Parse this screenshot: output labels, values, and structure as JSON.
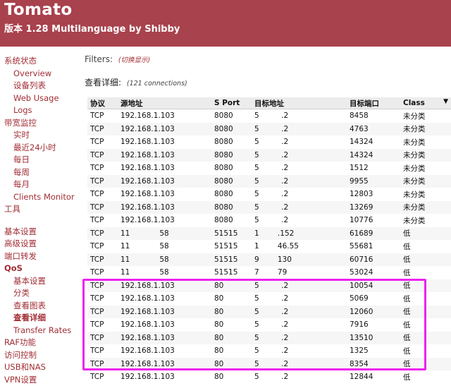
{
  "header": {
    "title": "Tomato",
    "subtitle": "版本 1.28 Multilanguage by Shibby"
  },
  "nav": [
    {
      "label": "系统状态",
      "level": 0
    },
    {
      "label": "Overview",
      "level": 1
    },
    {
      "label": "设备列表",
      "level": 1
    },
    {
      "label": "Web Usage",
      "level": 1
    },
    {
      "label": "Logs",
      "level": 1
    },
    {
      "label": "带宽监控",
      "level": 0
    },
    {
      "label": "实时",
      "level": 1
    },
    {
      "label": "最近24小时",
      "level": 1
    },
    {
      "label": "每日",
      "level": 1
    },
    {
      "label": "每周",
      "level": 1
    },
    {
      "label": "每月",
      "level": 1
    },
    {
      "label": "Clients Monitor",
      "level": 1
    },
    {
      "label": "工具",
      "level": 0
    },
    {
      "gap": true
    },
    {
      "label": "基本设置",
      "level": 0
    },
    {
      "label": "高级设置",
      "level": 0
    },
    {
      "label": "端口转发",
      "level": 0
    },
    {
      "label": "QoS",
      "level": 0,
      "bold": true
    },
    {
      "label": "基本设置",
      "level": 1
    },
    {
      "label": "分类",
      "level": 1
    },
    {
      "label": "查看图表",
      "level": 1
    },
    {
      "label": "查看详细",
      "level": 1,
      "active": true
    },
    {
      "label": "Transfer Rates",
      "level": 1
    },
    {
      "label": "RAF功能",
      "level": 0
    },
    {
      "label": "访问控制",
      "level": 0
    },
    {
      "label": "USB和NAS",
      "level": 0
    },
    {
      "label": "VPN设置",
      "level": 0
    }
  ],
  "filters": {
    "label": "Filters:",
    "toggle": "(切换显示)"
  },
  "details": {
    "title": "查看详细:",
    "count": "(121 connections)"
  },
  "table": {
    "headers": [
      "协议",
      "源地址",
      "S Port",
      "目标地址",
      "目标端口",
      "Class"
    ],
    "rows": [
      [
        "TCP",
        "192.168.1.103",
        "8080",
        "5      .2",
        "8458",
        "未分类"
      ],
      [
        "TCP",
        "192.168.1.103",
        "8080",
        "5      .2",
        "4763",
        "未分类"
      ],
      [
        "TCP",
        "192.168.1.103",
        "8080",
        "5      .2",
        "14324",
        "未分类"
      ],
      [
        "TCP",
        "192.168.1.103",
        "8080",
        "5      .2",
        "14324",
        "未分类"
      ],
      [
        "TCP",
        "192.168.1.103",
        "8080",
        "5      .2",
        "1512",
        "未分类"
      ],
      [
        "TCP",
        "192.168.1.103",
        "8080",
        "5      .2",
        "9955",
        "未分类"
      ],
      [
        "TCP",
        "192.168.1.103",
        "8080",
        "5      .2",
        "12803",
        "未分类"
      ],
      [
        "TCP",
        "192.168.1.103",
        "8080",
        "5      .2",
        "13269",
        "未分类"
      ],
      [
        "TCP",
        "192.168.1.103",
        "8080",
        "5      .2",
        "10776",
        "未分类"
      ],
      [
        "TCP",
        "11        58",
        "51515",
        "1     .152",
        "61689",
        "低"
      ],
      [
        "TCP",
        "11        58",
        "51515",
        "1     46.55",
        "55681",
        "低"
      ],
      [
        "TCP",
        "11        58",
        "51515",
        "9     130",
        "60716",
        "低"
      ],
      [
        "TCP",
        "11        58",
        "51515",
        "7     79",
        "53024",
        "低"
      ],
      [
        "TCP",
        "192.168.1.103",
        "80",
        "5      .2",
        "10054",
        "低"
      ],
      [
        "TCP",
        "192.168.1.103",
        "80",
        "5      .2",
        "5069",
        "低"
      ],
      [
        "TCP",
        "192.168.1.103",
        "80",
        "5      .2",
        "12060",
        "低"
      ],
      [
        "TCP",
        "192.168.1.103",
        "80",
        "5      .2",
        "7916",
        "低"
      ],
      [
        "TCP",
        "192.168.1.103",
        "80",
        "5      .2",
        "13510",
        "低"
      ],
      [
        "TCP",
        "192.168.1.103",
        "80",
        "5      .2",
        "1325",
        "低"
      ],
      [
        "TCP",
        "192.168.1.103",
        "80",
        "5      .2",
        "8354",
        "低"
      ],
      [
        "TCP",
        "192.168.1.103",
        "80",
        "5      .2",
        "12844",
        "低"
      ]
    ],
    "sort_icon": "sort-desc-icon"
  },
  "colors": {
    "header_bg": "#a8424d",
    "link": "#a12e35",
    "highlight": "#ee22ee"
  }
}
